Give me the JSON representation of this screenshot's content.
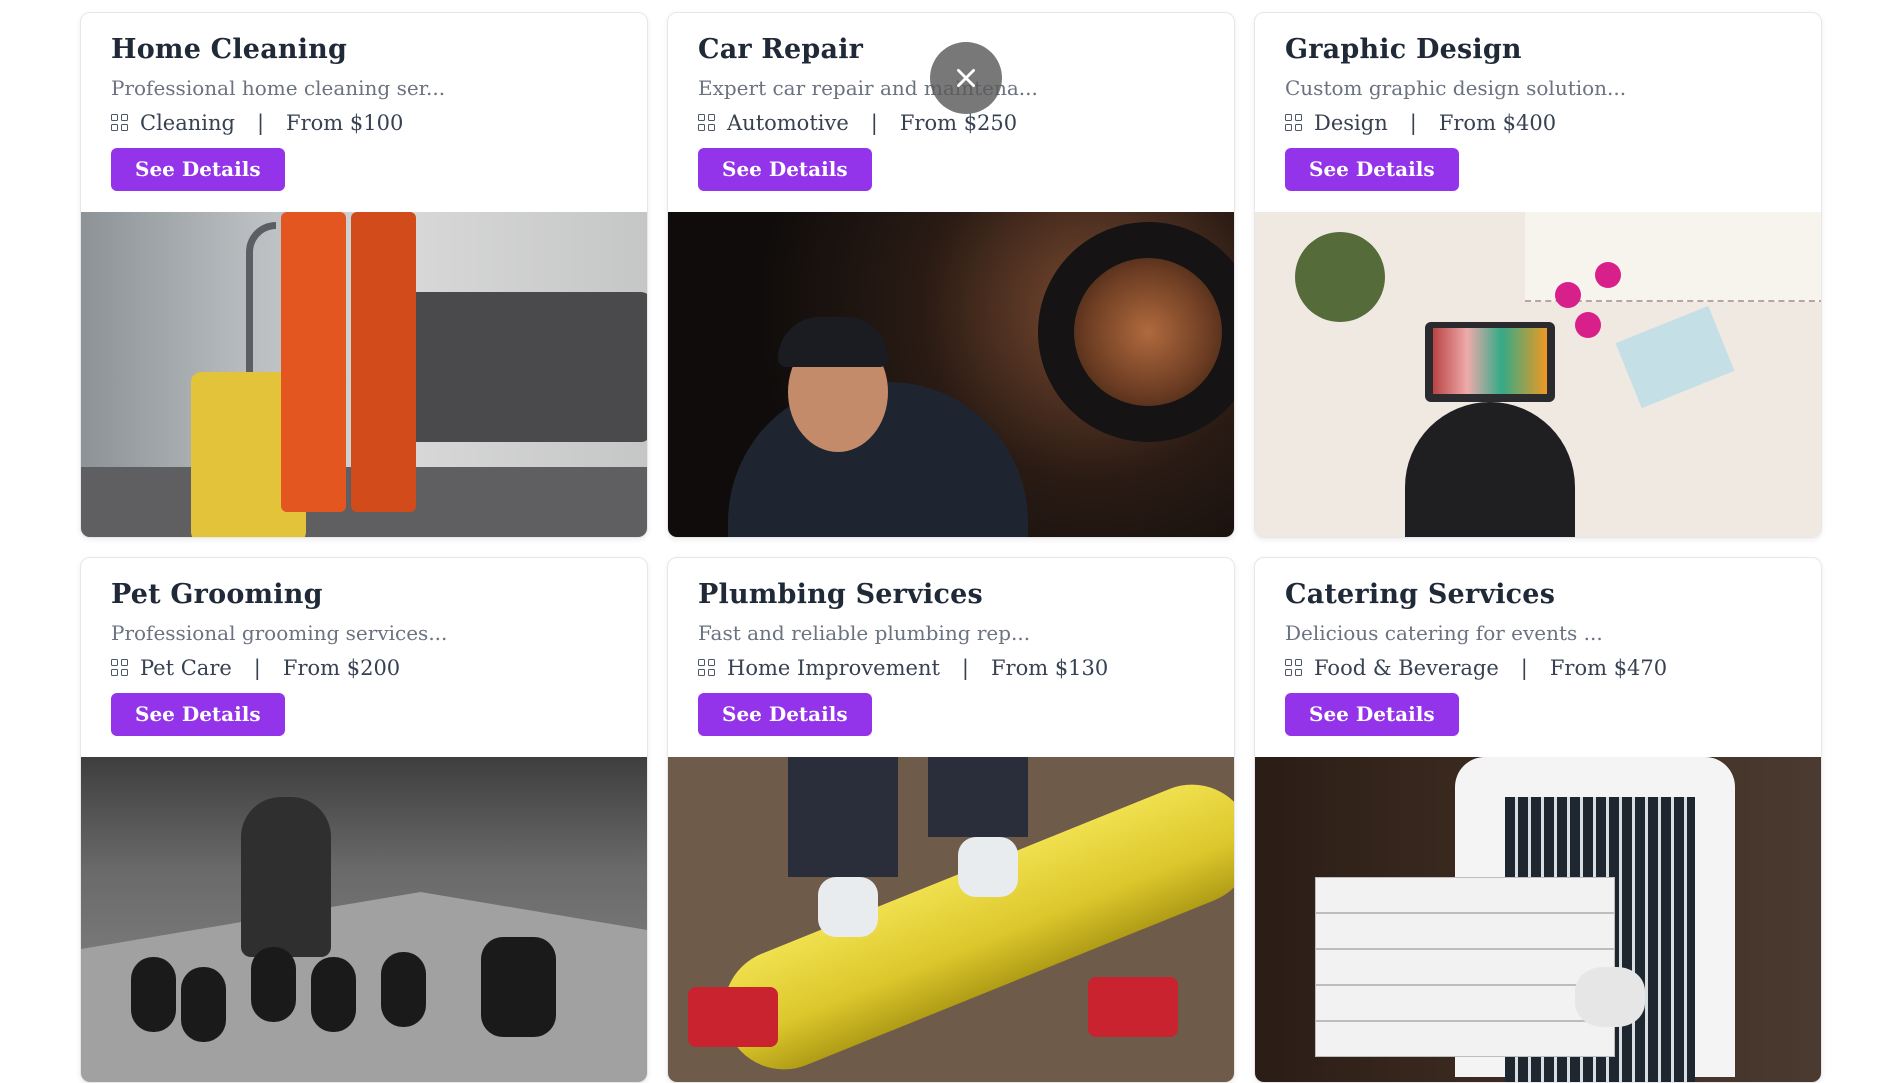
{
  "services": [
    {
      "title": "Home Cleaning",
      "description": "Professional home cleaning ser...",
      "category": "Cleaning",
      "price": "From $100",
      "button": "See Details",
      "image_alt": "cleaning-photo"
    },
    {
      "title": "Car Repair",
      "description": "Expert car repair and maintena...",
      "category": "Automotive",
      "price": "From $250",
      "button": "See Details",
      "image_alt": "car-repair-photo"
    },
    {
      "title": "Graphic Design",
      "description": "Custom graphic design solution...",
      "category": "Design",
      "price": "From $400",
      "button": "See Details",
      "image_alt": "graphic-design-photo"
    },
    {
      "title": "Pet Grooming",
      "description": "Professional grooming services...",
      "category": "Pet Care",
      "price": "From $200",
      "button": "See Details",
      "image_alt": "pet-grooming-photo"
    },
    {
      "title": "Plumbing Services",
      "description": "Fast and reliable plumbing rep...",
      "category": "Home Improvement",
      "price": "From $130",
      "button": "See Details",
      "image_alt": "plumbing-photo"
    },
    {
      "title": "Catering Services",
      "description": "Delicious catering for events ...",
      "category": "Food & Beverage",
      "price": "From $470",
      "button": "See Details",
      "image_alt": "catering-photo"
    }
  ],
  "separator": "|",
  "icons": {
    "category": "grid-icon",
    "close": "close-icon"
  },
  "colors": {
    "accent": "#9333ea",
    "title": "#1f2937",
    "muted": "#6b7280"
  }
}
